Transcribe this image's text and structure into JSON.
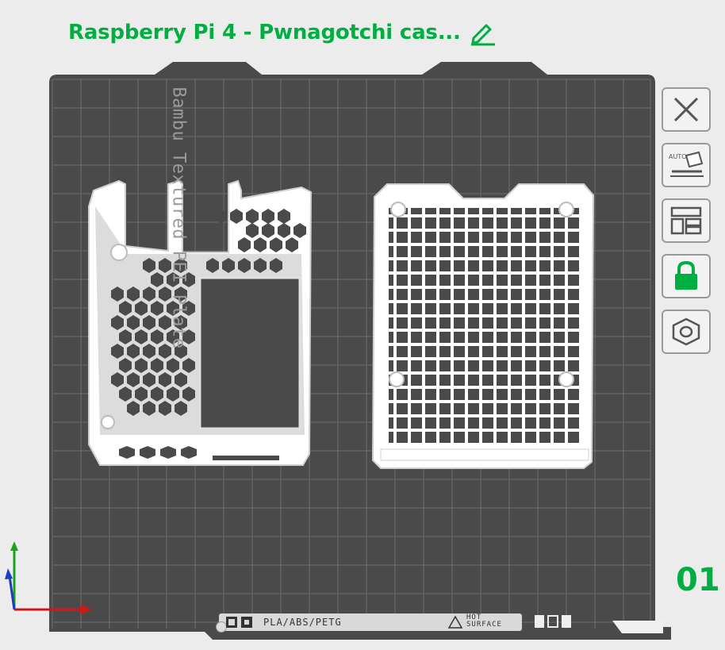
{
  "title": {
    "text": "Raspberry Pi 4 - Pwnagotchi cas..."
  },
  "plate": {
    "label": "Bambu Textured PEI Plate",
    "index": "01",
    "filament": "PLA/ABS/PETG",
    "surface": "HOT\nSURFACE",
    "bed_color": "#4a4a4a",
    "grid_color": "#707070",
    "model_color": "#ffffff"
  },
  "toolbar": {
    "items": [
      {
        "name": "close",
        "icon": "close-icon"
      },
      {
        "name": "auto-orient",
        "icon": "auto-orient-icon",
        "badge": "AUTO"
      },
      {
        "name": "arrange",
        "icon": "arrange-icon"
      },
      {
        "name": "lock",
        "icon": "lock-icon",
        "active": true
      },
      {
        "name": "plate-settings",
        "icon": "nut-icon"
      }
    ]
  },
  "accent_color": "#00ae42"
}
